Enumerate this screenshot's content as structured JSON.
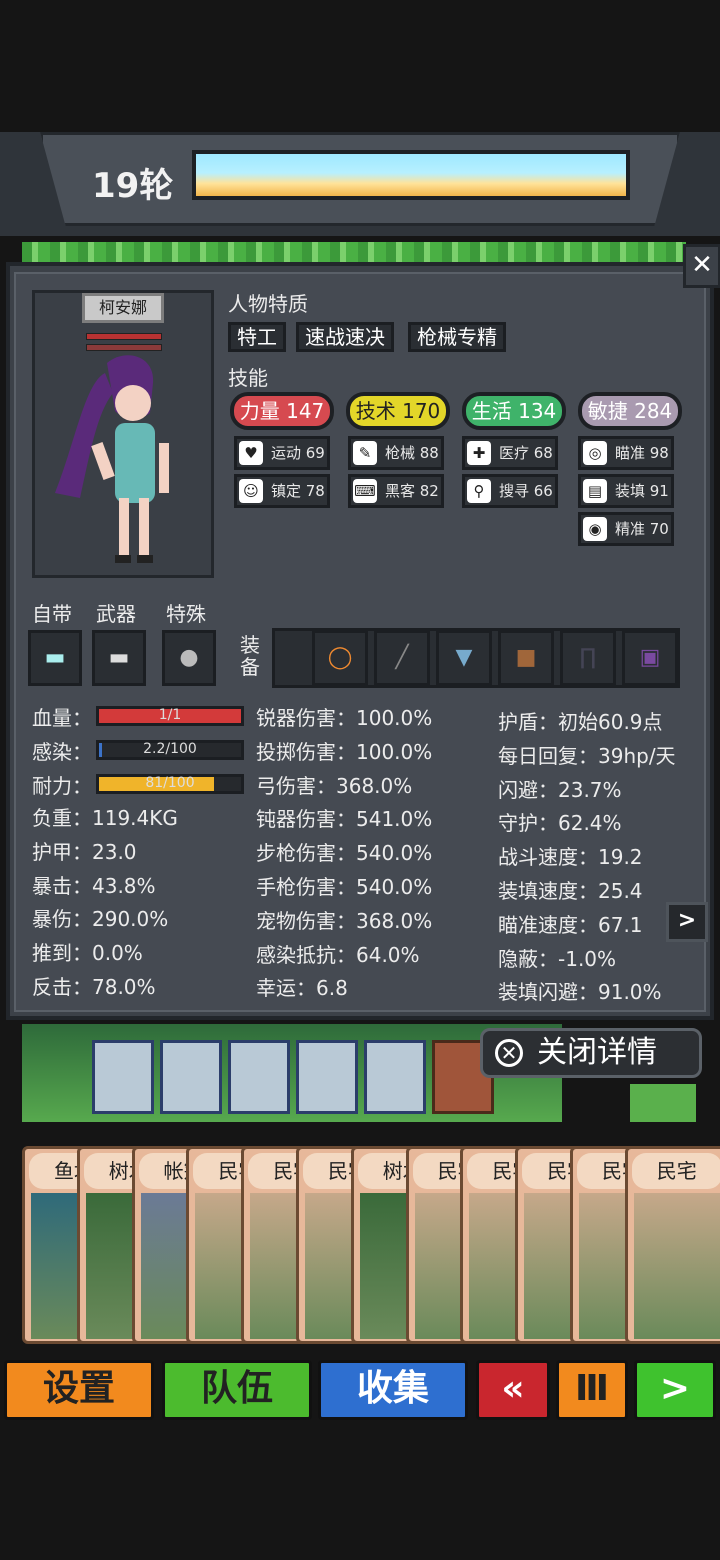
{
  "round": "19轮",
  "close_x": "✕",
  "character": {
    "name": "柯安娜"
  },
  "traits": {
    "title": "人物特质",
    "items": [
      "特工",
      "速战速决",
      "枪械专精"
    ]
  },
  "skills": {
    "title": "技能",
    "main": [
      {
        "label": "力量 147",
        "color": "#d64a50"
      },
      {
        "label": "技术 170",
        "color": "#e3d629"
      },
      {
        "label": "生活 134",
        "color": "#3fb36a"
      },
      {
        "label": "敏捷 284",
        "color": "#a99ab0"
      }
    ],
    "sub": [
      {
        "label": "运动 69",
        "icon": "♥"
      },
      {
        "label": "枪械 88",
        "icon": "✎"
      },
      {
        "label": "医疗 68",
        "icon": "✚"
      },
      {
        "label": "瞄准 98",
        "icon": "◎"
      },
      {
        "label": "镇定 78",
        "icon": "☺"
      },
      {
        "label": "黑客 82",
        "icon": "⌨"
      },
      {
        "label": "搜寻 66",
        "icon": "⚲"
      },
      {
        "label": "装填 91",
        "icon": "▤"
      },
      {
        "label": "精准 70",
        "icon": "◉"
      }
    ]
  },
  "gear": {
    "labels": [
      "自带",
      "武器",
      "特殊"
    ],
    "equip_label": "装\n备"
  },
  "bars": [
    {
      "label": "血量：",
      "text": "1/1",
      "fill": 1.0,
      "color": "#d33a3a"
    },
    {
      "label": "感染：",
      "text": "2.2/100",
      "fill": 0.022,
      "color": "#3c73c9"
    },
    {
      "label": "耐力：",
      "text": "81/100",
      "fill": 0.81,
      "color": "#f0b42a"
    }
  ],
  "stats_col1": [
    "负重：119.4KG",
    "护甲：23.0",
    "暴击：43.8%",
    "暴伤：290.0%",
    "推到：0.0%",
    "反击：78.0%"
  ],
  "stats_col2": [
    "锐器伤害：100.0%",
    "投掷伤害：100.0%",
    "弓伤害：368.0%",
    "钝器伤害：541.0%",
    "步枪伤害：540.0%",
    "手枪伤害：540.0%",
    "宠物伤害：368.0%",
    "感染抵抗：64.0%",
    "幸运：6.8"
  ],
  "stats_col3": [
    "护盾：初始60.9点",
    "每日回复：39hp/天",
    "闪避：23.7%",
    "守护：62.4%",
    "战斗速度：19.2",
    "装填速度：25.4",
    "瞄准速度：67.1",
    "隐蔽：-1.0%",
    "装填闪避：91.0%"
  ],
  "next_arrow": ">",
  "close_detail": "关闭详情",
  "cards": [
    "鱼塘",
    "树木",
    "帐篷",
    "民宅",
    "民宅",
    "民宅",
    "树木",
    "民宅",
    "民宅",
    "民宅",
    "民宅",
    "民宅"
  ],
  "buttons": [
    {
      "label": "设置",
      "color": "#f28a1e"
    },
    {
      "label": "队伍",
      "color": "#4cbb2e"
    },
    {
      "label": "收集",
      "color": "#2e6fd0"
    },
    {
      "label": "«",
      "color": "#c9262e"
    },
    {
      "label": "Ⅲ",
      "color": "#f28a1e"
    },
    {
      "label": ">",
      "color": "#3fc22e"
    }
  ]
}
